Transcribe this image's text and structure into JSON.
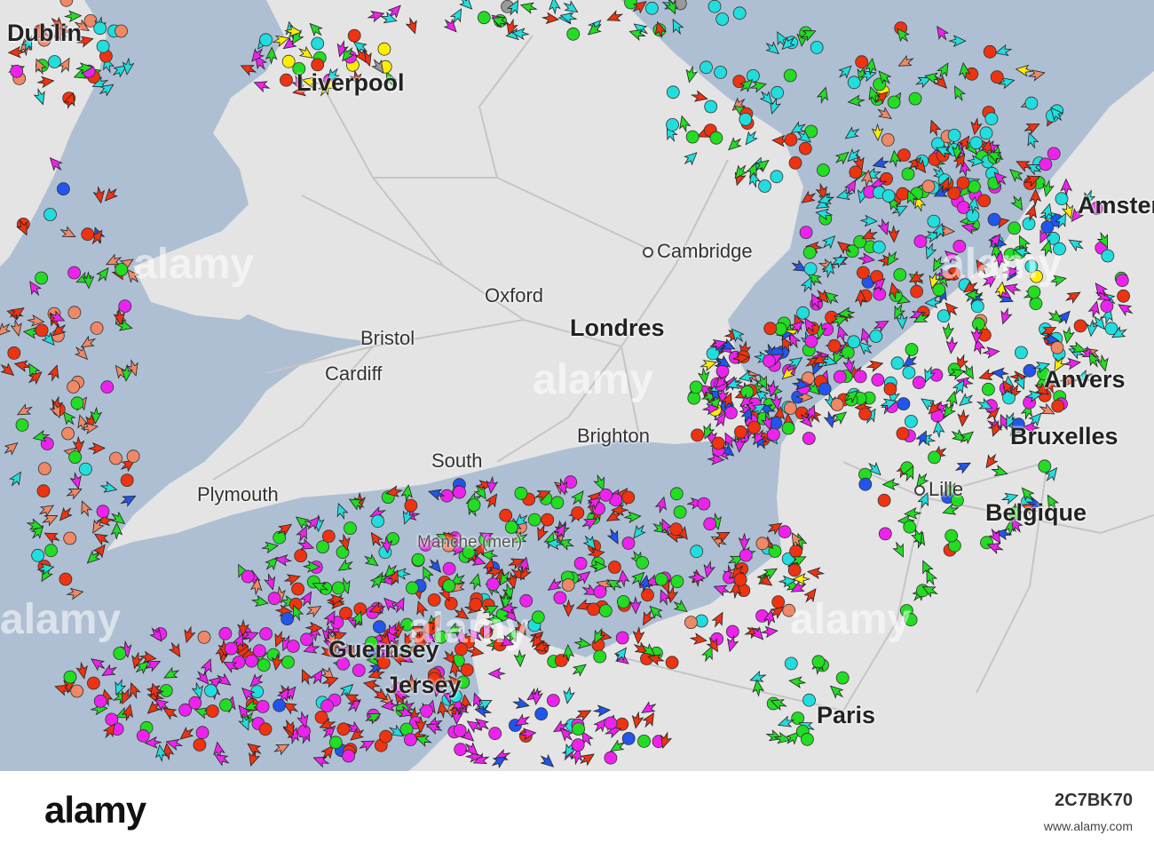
{
  "map": {
    "place_labels": [
      {
        "name": "Dublin",
        "text": "Dublin"
      },
      {
        "name": "Liverpool",
        "text": "Liverpool"
      },
      {
        "name": "Cambridge",
        "text": "Cambridge"
      },
      {
        "name": "Oxford",
        "text": "Oxford"
      },
      {
        "name": "Londres",
        "text": "Londres"
      },
      {
        "name": "Bristol",
        "text": "Bristol"
      },
      {
        "name": "Cardiff",
        "text": "Cardiff"
      },
      {
        "name": "Brighton",
        "text": "Brighton"
      },
      {
        "name": "Southampton",
        "text": "South"
      },
      {
        "name": "Plymouth",
        "text": "Plymouth"
      },
      {
        "name": "Bruxelles",
        "text": "Bruxelles"
      },
      {
        "name": "Anvers",
        "text": "Anvers"
      },
      {
        "name": "Lille",
        "text": "Lille"
      },
      {
        "name": "Belgique",
        "text": "Belgique"
      },
      {
        "name": "Guernsey",
        "text": "Guernsey"
      },
      {
        "name": "Jersey",
        "text": "Jersey"
      },
      {
        "name": "Paris",
        "text": "Paris"
      },
      {
        "name": "Manche",
        "text": "Manche (mer)"
      },
      {
        "name": "Amsterdam",
        "text": "Amster"
      }
    ],
    "colors": {
      "sea": "#aebfd3",
      "land": "#e4e4e4",
      "roads": "#c8c8c8",
      "cargo": "#22dd22",
      "tanker": "#ee3311",
      "passenger": "#2255ee",
      "pleasure": "#ee22ee",
      "tug": "#22dddd",
      "fishing": "#ee8866",
      "highspeed": "#ffee00",
      "unknown": "#999999"
    }
  },
  "watermark": "alamy",
  "footer": {
    "brand": "alamy",
    "image_id": "2C7BK70",
    "url": "www.alamy.com"
  }
}
